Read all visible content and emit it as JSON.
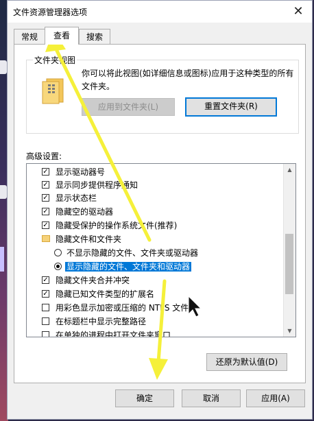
{
  "window": {
    "title": "文件资源管理器选项"
  },
  "tabs": [
    {
      "label": "常规",
      "active": false
    },
    {
      "label": "查看",
      "active": true
    },
    {
      "label": "搜索",
      "active": false
    }
  ],
  "folder_view": {
    "legend": "文件夹视图",
    "description": "你可以将此视图(如详细信息或图标)应用于这种类型的所有文件夹。",
    "apply_button": "应用到文件夹(L)",
    "reset_button": "重置文件夹(R)"
  },
  "advanced": {
    "label": "高级设置:",
    "items": [
      {
        "type": "checkbox",
        "checked": true,
        "label": "显示驱动器号",
        "indent": 1
      },
      {
        "type": "checkbox",
        "checked": true,
        "label": "显示同步提供程序通知",
        "indent": 1
      },
      {
        "type": "checkbox",
        "checked": true,
        "label": "显示状态栏",
        "indent": 1
      },
      {
        "type": "checkbox",
        "checked": true,
        "label": "隐藏空的驱动器",
        "indent": 1
      },
      {
        "type": "checkbox",
        "checked": true,
        "label": "隐藏受保护的操作系统文件(推荐)",
        "indent": 1
      },
      {
        "type": "folder",
        "checked": false,
        "label": "隐藏文件和文件夹",
        "indent": 1
      },
      {
        "type": "radio",
        "checked": false,
        "label": "不显示隐藏的文件、文件夹或驱动器",
        "indent": 2
      },
      {
        "type": "radio",
        "checked": true,
        "label": "显示隐藏的文件、文件夹和驱动器",
        "indent": 2,
        "selected": true
      },
      {
        "type": "checkbox",
        "checked": true,
        "label": "隐藏文件夹合并冲突",
        "indent": 1
      },
      {
        "type": "checkbox",
        "checked": true,
        "label": "隐藏已知文件类型的扩展名",
        "indent": 1
      },
      {
        "type": "checkbox",
        "checked": false,
        "label": "用彩色显示加密或压缩的 NTFS 文件",
        "indent": 1
      },
      {
        "type": "checkbox",
        "checked": false,
        "label": "在标题栏中显示完整路径",
        "indent": 1
      },
      {
        "type": "checkbox",
        "checked": false,
        "label": "在单独的进程中打开文件夹窗口",
        "indent": 1
      }
    ],
    "restore_button": "还原为默认值(D)"
  },
  "footer": {
    "ok": "确定",
    "cancel": "取消",
    "apply": "应用(A)"
  },
  "colors": {
    "accent": "#0078d7",
    "annotation": "#f5f03a"
  }
}
